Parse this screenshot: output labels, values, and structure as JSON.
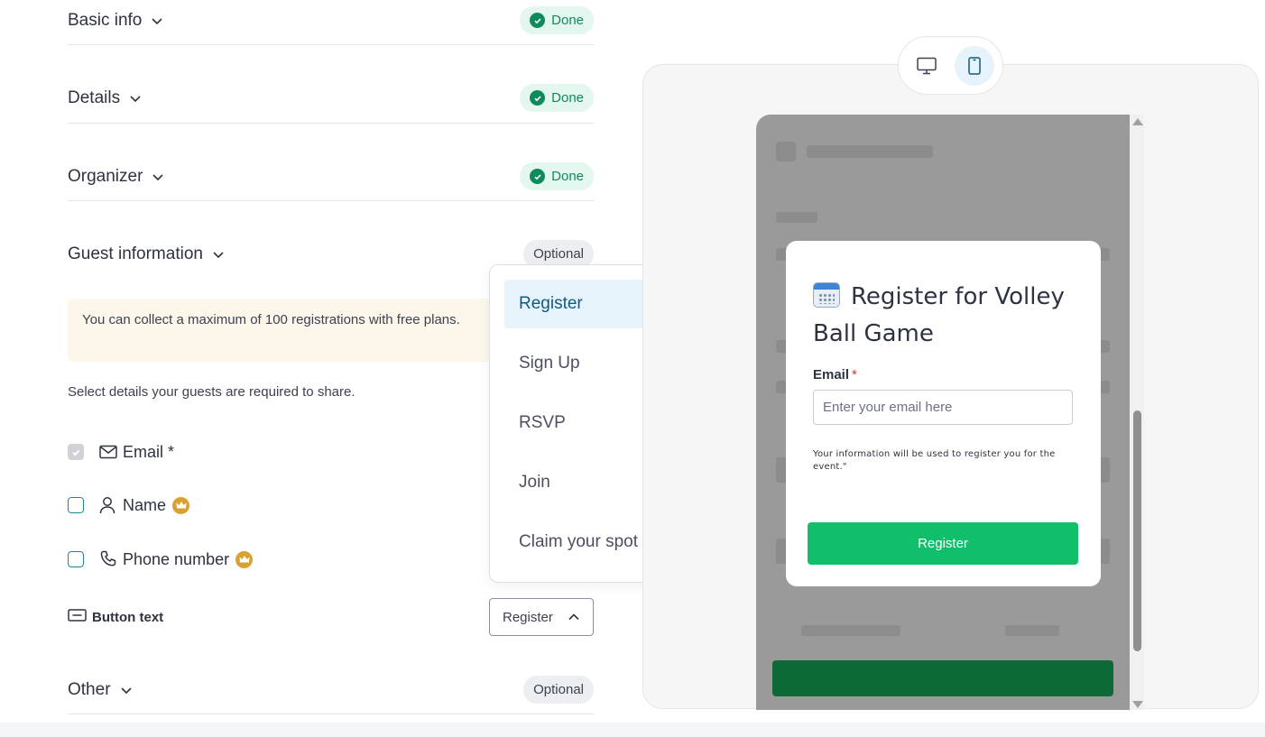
{
  "sections": {
    "basic_info": {
      "label": "Basic info",
      "status": "Done"
    },
    "details": {
      "label": "Details",
      "status": "Done"
    },
    "organizer": {
      "label": "Organizer",
      "status": "Done"
    },
    "guest_information": {
      "label": "Guest information",
      "status": "Optional"
    },
    "other": {
      "label": "Other",
      "status": "Optional"
    }
  },
  "guest_info": {
    "notice": "You can collect a maximum of 100 registrations with free plans.",
    "helper": "Select details your guests are required to share.",
    "fields": [
      {
        "label": "Email *",
        "checked": true,
        "icon": "mail-icon",
        "premium": false
      },
      {
        "label": "Name",
        "checked": false,
        "icon": "user-icon",
        "premium": true
      },
      {
        "label": "Phone number",
        "checked": false,
        "icon": "phone-icon",
        "premium": true
      }
    ],
    "button_text_label": "Button text",
    "button_text_value": "Register"
  },
  "dropdown": {
    "options": [
      "Register",
      "Sign Up",
      "RSVP",
      "Join",
      "Claim your spot"
    ],
    "selected": "Register"
  },
  "preview": {
    "device_options": [
      "desktop-icon",
      "mobile-icon"
    ],
    "active_device": "mobile",
    "modal": {
      "title": "Register for Volley Ball Game",
      "email_label": "Email",
      "email_required_mark": "*",
      "email_placeholder": "Enter your email here",
      "disclaimer": "Your information will be used to register you for the event.\"",
      "button": "Register"
    }
  },
  "colors": {
    "done_badge_bg": "#e3f7ef",
    "done_badge_text": "#0f8a5f",
    "selected_option_bg": "#e6f3fb",
    "cta_green": "#11bf6a",
    "premium_crown": "#d9a032"
  }
}
